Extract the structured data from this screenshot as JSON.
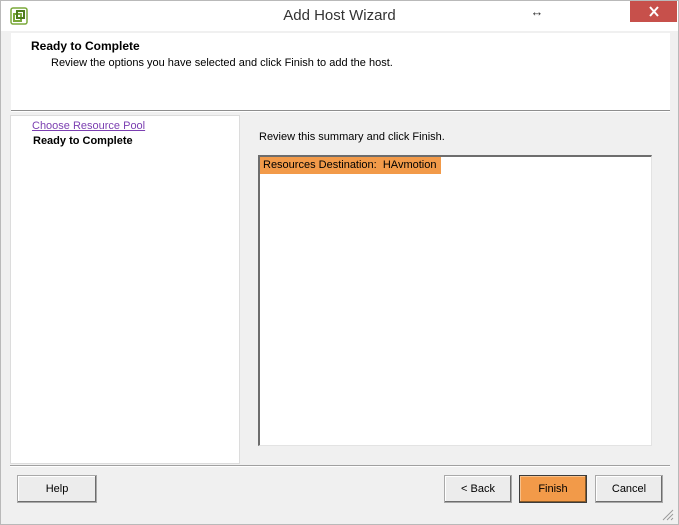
{
  "window": {
    "title": "Add Host Wizard",
    "resize_glyph": "↔",
    "icons": {
      "app": "vsphere-app-icon",
      "close": "close-icon",
      "resize": "resize-arrows-icon",
      "grip": "resize-grip-icon"
    }
  },
  "header": {
    "title": "Ready to Complete",
    "description": "Review the options you have selected and click Finish to add the host."
  },
  "steps": {
    "items": [
      {
        "label": "Choose Resource Pool",
        "state": "link"
      },
      {
        "label": "Ready to Complete",
        "state": "current"
      }
    ]
  },
  "content": {
    "review_label": "Review this summary and click Finish.",
    "summary": {
      "items": [
        {
          "label": "Resources Destination:",
          "value": "HAvmotion"
        }
      ]
    }
  },
  "footer": {
    "help_label": "Help",
    "back_label": "< Back",
    "finish_label": "Finish",
    "cancel_label": "Cancel"
  },
  "colors": {
    "accent": "#f29a49",
    "link": "#7b3fb1",
    "close_button": "#c7504b"
  }
}
